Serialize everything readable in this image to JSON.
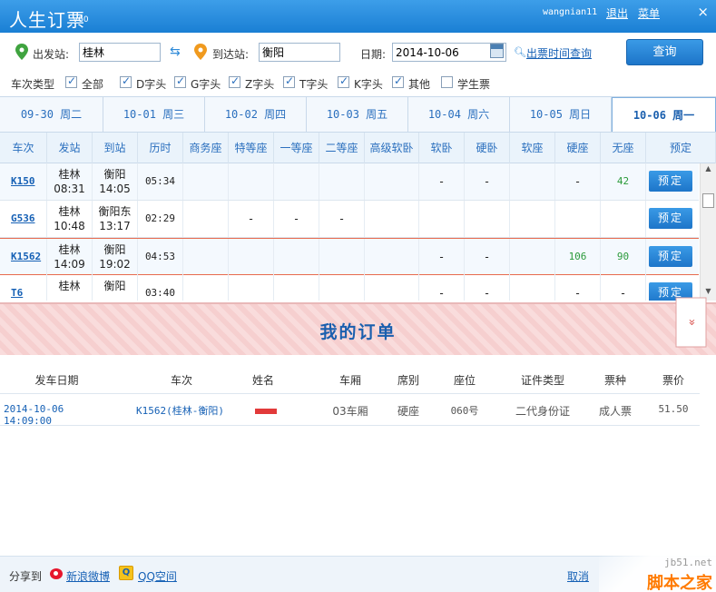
{
  "titlebar": {
    "title": "人生订票",
    "version": "V60",
    "user": "wangnian11",
    "logout": "退出",
    "menu": "菜单",
    "close": "×"
  },
  "search": {
    "from_label": "出发站:",
    "from_value": "桂林",
    "to_label": "到达站:",
    "to_value": "衡阳",
    "date_label": "日期:",
    "date_value": "2014-10-06",
    "sale_time_link": "出票时间查询",
    "query_button": "查询"
  },
  "train_types": {
    "label": "车次类型",
    "options": [
      {
        "label": "全部",
        "checked": true
      },
      {
        "label": "D字头",
        "checked": true
      },
      {
        "label": "G字头",
        "checked": true
      },
      {
        "label": "Z字头",
        "checked": true
      },
      {
        "label": "T字头",
        "checked": true
      },
      {
        "label": "K字头",
        "checked": true
      },
      {
        "label": "其他",
        "checked": true
      },
      {
        "label": "学生票",
        "checked": false
      }
    ]
  },
  "date_tabs": [
    {
      "label": "09-30 周二"
    },
    {
      "label": "10-01 周三"
    },
    {
      "label": "10-02 周四"
    },
    {
      "label": "10-03 周五"
    },
    {
      "label": "10-04 周六"
    },
    {
      "label": "10-05 周日"
    },
    {
      "label": "10-06 周一",
      "active": true
    }
  ],
  "train_table": {
    "headers": [
      "车次",
      "发站",
      "到站",
      "历时",
      "商务座",
      "特等座",
      "一等座",
      "二等座",
      "高级软卧",
      "软卧",
      "硬卧",
      "软座",
      "硬座",
      "无座",
      "预定"
    ],
    "rows": [
      {
        "train": "K150",
        "from": "桂林",
        "dep": "08:31",
        "to": "衡阳",
        "arr": "14:05",
        "duration": "05:34",
        "seats": [
          "",
          "",
          "",
          "",
          "",
          "-",
          "-",
          "",
          "-",
          "42"
        ],
        "book": "预定"
      },
      {
        "train": "G536",
        "from": "桂林",
        "dep": "10:48",
        "to": "衡阳东",
        "arr": "13:17",
        "duration": "02:29",
        "seats": [
          "",
          "-",
          "-",
          "-",
          "",
          "",
          "",
          "",
          "",
          ""
        ],
        "book": "预定"
      },
      {
        "train": "K1562",
        "from": "桂林",
        "dep": "14:09",
        "to": "衡阳",
        "arr": "19:02",
        "duration": "04:53",
        "seats": [
          "",
          "",
          "",
          "",
          "",
          "-",
          "-",
          "",
          "106",
          "90"
        ],
        "book": "预定"
      },
      {
        "train": "T6",
        "from": "桂林",
        "dep": "",
        "to": "衡阳",
        "arr": "",
        "duration": "03:40",
        "seats": [
          "",
          "",
          "",
          "",
          "",
          "-",
          "-",
          "",
          "-",
          "-"
        ],
        "book": "预定"
      }
    ]
  },
  "orders": {
    "title": "我的订单",
    "collapse": "»",
    "headers": [
      "发车日期",
      "车次",
      "姓名",
      "车厢",
      "席别",
      "座位",
      "证件类型",
      "票种",
      "票价"
    ],
    "rows": [
      {
        "date": "2014-10-06 14:09:00",
        "train": "K1562(桂林-衡阳)",
        "name": "",
        "car": "03车厢",
        "class": "硬座",
        "seat": "060号",
        "id_type": "二代身份证",
        "ticket_type": "成人票",
        "price": "51.50"
      }
    ]
  },
  "footer": {
    "share_label": "分享到",
    "weibo": "新浪微博",
    "qzone": "QQ空间",
    "cancel": "取消"
  },
  "watermark": {
    "site": "jb51.net",
    "brand": "脚本之家"
  },
  "colors": {
    "accent": "#1a7fd4",
    "link": "#1560b5",
    "available": "#2a9a3a",
    "banner": "#f9dcdc"
  }
}
